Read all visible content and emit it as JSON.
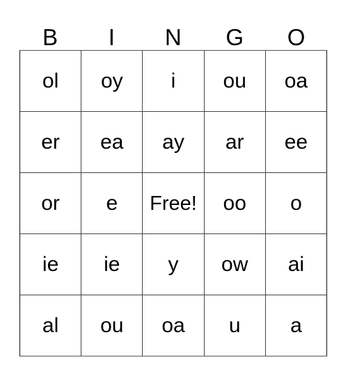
{
  "card": {
    "title": "BINGO",
    "columns": [
      "B",
      "I",
      "N",
      "G",
      "O"
    ],
    "free_space_label": "Free!",
    "colors": {
      "background": "#ffffff",
      "text": "#000000",
      "grid_line": "#444444",
      "outer_border": "#111111"
    },
    "rows": [
      {
        "cells": [
          "ol",
          "oy",
          "i",
          "ou",
          "oa"
        ]
      },
      {
        "cells": [
          "er",
          "ea",
          "ay",
          "ar",
          "ee"
        ]
      },
      {
        "cells": [
          "or",
          "e",
          "Free!",
          "oo",
          "o"
        ]
      },
      {
        "cells": [
          "ie",
          "ie",
          "y",
          "ow",
          "ai"
        ]
      },
      {
        "cells": [
          "al",
          "ou",
          "oa",
          "u",
          "a"
        ]
      }
    ]
  }
}
